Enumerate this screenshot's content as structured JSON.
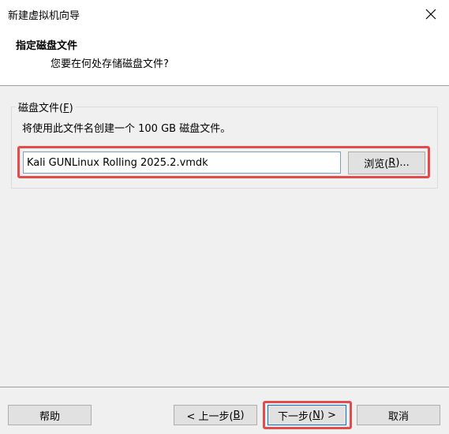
{
  "window": {
    "title": "新建虚拟机向导",
    "close_icon": "close-icon"
  },
  "header": {
    "title": "指定磁盘文件",
    "subtitle": "您要在何处存储磁盘文件?"
  },
  "disk_group": {
    "label_text": "磁盘文件(",
    "label_accel": "F",
    "label_end": ")",
    "description": "将使用此文件名创建一个 100 GB 磁盘文件。",
    "filename": "Kali GUNLinux Rolling 2025.2.vmdk",
    "browse": {
      "pre": "浏览(",
      "accel": "R",
      "post": ")..."
    }
  },
  "footer": {
    "help": "帮助",
    "back": {
      "pre": "< 上一步(",
      "accel": "B",
      "post": ")"
    },
    "next": {
      "pre": "下一步(",
      "accel": "N",
      "post": ") >"
    },
    "cancel": "取消"
  },
  "colors": {
    "highlight": "#e44b4b",
    "focus_border": "#0078d7"
  }
}
